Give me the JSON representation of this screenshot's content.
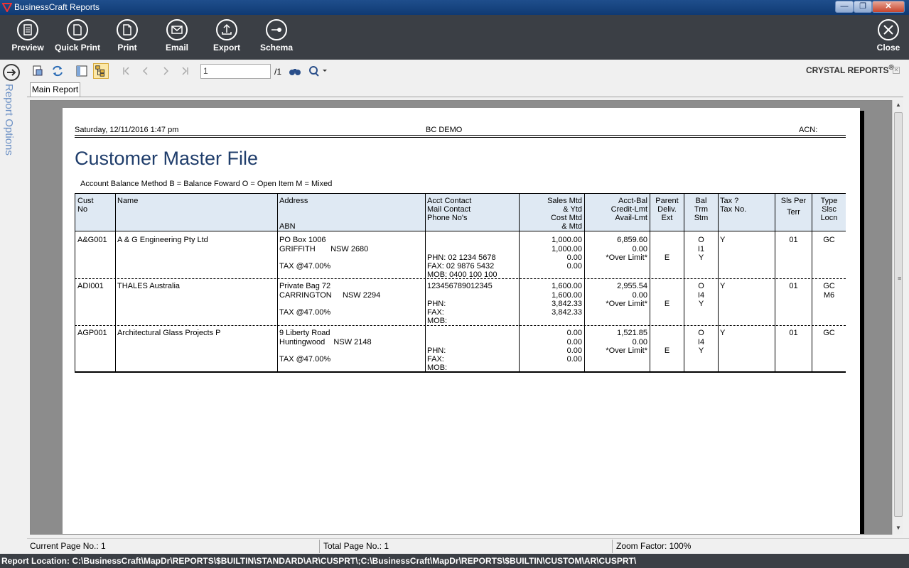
{
  "window": {
    "title": "BusinessCraft Reports",
    "min_label": "—",
    "max_label": "❐",
    "close_label": "✕"
  },
  "toolbar": {
    "preview": "Preview",
    "quick_print": "Quick Print",
    "print": "Print",
    "email": "Email",
    "export": "Export",
    "schema": "Schema",
    "close": "Close"
  },
  "sidebar": {
    "label": "Report Options"
  },
  "viewer": {
    "page_input": "1",
    "page_total": "/1",
    "brand": "CRYSTAL REPORTS",
    "brand_mark": "®",
    "tab": "Main Report"
  },
  "report": {
    "date": "Saturday, 12/11/2016  1:47 pm",
    "company": "BC DEMO",
    "acn_label": "ACN:",
    "title": "Customer Master File",
    "method_note": "Account Balance Method   B = Balance Foward   O = Open Item   M = Mixed",
    "headers": {
      "cust_no": [
        "Cust",
        "No"
      ],
      "name": "Name",
      "address": "Address",
      "abn": "ABN",
      "contact": [
        "Acct Contact",
        "Mail Contact",
        "Phone No's"
      ],
      "sales": [
        "Sales Mtd",
        "&   Ytd",
        "Cost Mtd",
        "&   Mtd"
      ],
      "acct": [
        "Acct-Bal",
        "Credit-Lmt",
        "Avail-Lmt"
      ],
      "parent": [
        "Parent",
        "Deliv.",
        "Ext"
      ],
      "bal": [
        "Bal",
        "Trm",
        "Stm"
      ],
      "tax": [
        "Tax ?",
        "Tax No."
      ],
      "sls": [
        "Sls Per",
        "Terr"
      ],
      "type": [
        "Type",
        "Slsc",
        "Locn"
      ]
    },
    "rows": [
      {
        "cust_no": "A&G001",
        "name": "A & G Engineering Pty Ltd",
        "address": [
          "PO Box 1006",
          "GRIFFITH       NSW 2680",
          "",
          "TAX @47.00%"
        ],
        "contact": [
          "",
          "",
          "PHN: 02 1234 5678",
          "FAX: 02 9876 5432",
          "MOB: 0400 100 100"
        ],
        "sales": [
          "1,000.00",
          "1,000.00",
          "0.00",
          "0.00"
        ],
        "acct": [
          "6,859.60",
          "0.00",
          "*Over Limit*"
        ],
        "parent": "E",
        "bal": [
          "O",
          "I1",
          "Y"
        ],
        "tax": "Y",
        "sls": "01",
        "type": [
          "GC",
          ""
        ]
      },
      {
        "cust_no": "ADI001",
        "name": "THALES Australia",
        "address": [
          "Private Bag 72",
          "CARRINGTON     NSW 2294",
          "",
          "TAX @47.00%"
        ],
        "contact": [
          "123456789012345",
          "",
          "PHN:",
          "FAX:",
          "MOB:"
        ],
        "sales": [
          "1,600.00",
          "1,600.00",
          "3,842.33",
          "3,842.33"
        ],
        "acct": [
          "2,955.54",
          "0.00",
          "*Over Limit*"
        ],
        "parent": "E",
        "bal": [
          "O",
          "I4",
          "Y"
        ],
        "tax": "Y",
        "sls": "01",
        "type": [
          "GC",
          "M6"
        ]
      },
      {
        "cust_no": "AGP001",
        "name": "Architectural Glass Projects P",
        "address": [
          "9 Liberty Road",
          "Huntingwood    NSW 2148",
          "",
          "TAX @47.00%"
        ],
        "contact": [
          "",
          "",
          "PHN:",
          "FAX:",
          "MOB:"
        ],
        "sales": [
          "0.00",
          "0.00",
          "0.00",
          "0.00"
        ],
        "acct": [
          "1,521.85",
          "0.00",
          "*Over Limit*"
        ],
        "parent": "E",
        "bal": [
          "O",
          "I4",
          "Y"
        ],
        "tax": "Y",
        "sls": "01",
        "type": [
          "GC",
          ""
        ]
      }
    ]
  },
  "status": {
    "current_page": "Current Page No.: 1",
    "total_page": "Total Page No.: 1",
    "zoom": "Zoom Factor: 100%"
  },
  "report_location": "Report Location: C:\\BusinessCraft\\MapDr\\REPORTS\\$BUILTIN\\STANDARD\\AR\\CUSPRT\\;C:\\BusinessCraft\\MapDr\\REPORTS\\$BUILTIN\\CUSTOM\\AR\\CUSPRT\\"
}
